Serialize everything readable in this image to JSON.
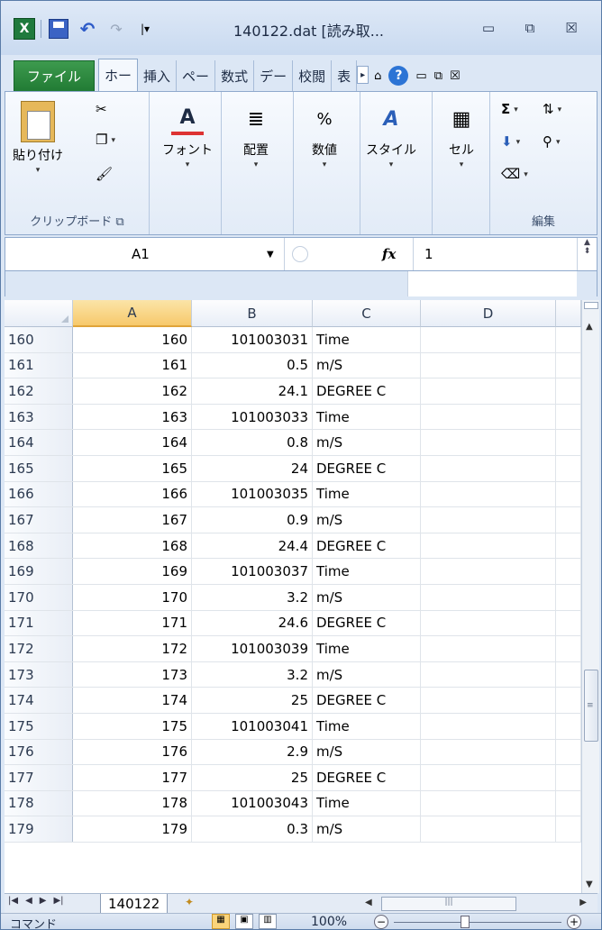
{
  "window": {
    "title": "140122.dat  [読み取...",
    "controls": {
      "minimize": "▭",
      "restore": "⧉",
      "close": "☒"
    }
  },
  "qat": {
    "undo": "↶",
    "redo": "↷",
    "customize": "|▾"
  },
  "tabs": [
    {
      "label": "ファイル"
    },
    {
      "label": "ホー"
    },
    {
      "label": "挿入"
    },
    {
      "label": "ペー"
    },
    {
      "label": "数式"
    },
    {
      "label": "デー"
    },
    {
      "label": "校閲"
    },
    {
      "label": "表"
    }
  ],
  "ribbon": {
    "clipboard": {
      "paste": "貼り付け",
      "label": "クリップボード"
    },
    "font": {
      "label": "フォント"
    },
    "alignment": {
      "label": "配置"
    },
    "number": {
      "label": "数値",
      "symbol": "%"
    },
    "styles": {
      "label": "スタイル"
    },
    "cells": {
      "label": "セル"
    },
    "editing": {
      "label": "編集"
    }
  },
  "formula_bar": {
    "name_box": "A1",
    "fx": "fx",
    "value": "1"
  },
  "grid": {
    "columns": [
      "A",
      "B",
      "C",
      "D"
    ],
    "rows": [
      {
        "n": "160",
        "a": "160",
        "b": "101003031",
        "c": "Time"
      },
      {
        "n": "161",
        "a": "161",
        "b": "0.5",
        "c": " m/S"
      },
      {
        "n": "162",
        "a": "162",
        "b": "24.1",
        "c": "DEGREE C"
      },
      {
        "n": "163",
        "a": "163",
        "b": "101003033",
        "c": "Time"
      },
      {
        "n": "164",
        "a": "164",
        "b": "0.8",
        "c": " m/S"
      },
      {
        "n": "165",
        "a": "165",
        "b": "24",
        "c": "DEGREE C"
      },
      {
        "n": "166",
        "a": "166",
        "b": "101003035",
        "c": "Time"
      },
      {
        "n": "167",
        "a": "167",
        "b": "0.9",
        "c": " m/S"
      },
      {
        "n": "168",
        "a": "168",
        "b": "24.4",
        "c": "DEGREE C"
      },
      {
        "n": "169",
        "a": "169",
        "b": "101003037",
        "c": "Time"
      },
      {
        "n": "170",
        "a": "170",
        "b": "3.2",
        "c": " m/S"
      },
      {
        "n": "171",
        "a": "171",
        "b": "24.6",
        "c": "DEGREE C"
      },
      {
        "n": "172",
        "a": "172",
        "b": "101003039",
        "c": "Time"
      },
      {
        "n": "173",
        "a": "173",
        "b": "3.2",
        "c": " m/S"
      },
      {
        "n": "174",
        "a": "174",
        "b": "25",
        "c": "DEGREE C"
      },
      {
        "n": "175",
        "a": "175",
        "b": "101003041",
        "c": "Time"
      },
      {
        "n": "176",
        "a": "176",
        "b": "2.9",
        "c": " m/S"
      },
      {
        "n": "177",
        "a": "177",
        "b": "25",
        "c": "DEGREE C"
      },
      {
        "n": "178",
        "a": "178",
        "b": "101003043",
        "c": "Time"
      },
      {
        "n": "179",
        "a": "179",
        "b": "0.3",
        "c": " m/S"
      }
    ]
  },
  "sheet_tabs": {
    "active": "140122"
  },
  "status_bar": {
    "mode": "コマンド",
    "zoom": "100%"
  }
}
